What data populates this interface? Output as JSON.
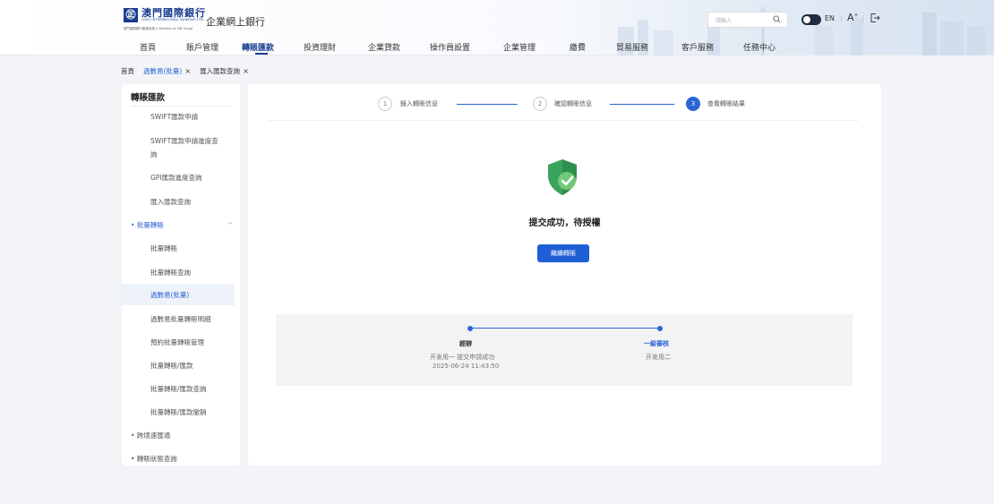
{
  "header": {
    "logo_mark": "㊣",
    "bank_name_cn": "澳門國際銀行",
    "bank_name_en": "LUSO INTERNATIONAL BANKING LTD.",
    "sub_text": "廈門國際銀行集團成員 A Member of XIB Group",
    "app_title": "企業網上銀行",
    "search_placeholder": "請輸入",
    "lang_label": "EN",
    "font_size_label": "A",
    "font_size_sup": "+"
  },
  "nav": {
    "items": [
      {
        "label": "首頁"
      },
      {
        "label": "賬戶管理"
      },
      {
        "label": "轉賬匯款"
      },
      {
        "label": "投資理財"
      },
      {
        "label": "企業貸款"
      },
      {
        "label": "操作員設置"
      },
      {
        "label": "企業管理"
      },
      {
        "label": "繳費"
      },
      {
        "label": "貿易服務"
      },
      {
        "label": "客戶服務"
      },
      {
        "label": "任務中心"
      }
    ],
    "active_index": 2
  },
  "tabs": [
    {
      "label": "首頁",
      "closable": false
    },
    {
      "label": "過數易(批量)",
      "closable": true,
      "active": true
    },
    {
      "label": "匯入匯款查詢",
      "closable": true
    }
  ],
  "sidebar": {
    "title": "轉賬匯款",
    "items": [
      {
        "label": "SWIFT匯款申請"
      },
      {
        "label": "SWIFT匯款申請進度查"
      },
      {
        "label": "詢"
      },
      {
        "label": "GPI匯款進度查詢"
      },
      {
        "label": "匯入匯款查詢"
      },
      {
        "label": "• 批量轉賬"
      },
      {
        "label": "批量轉賬"
      },
      {
        "label": "批量轉賬查詢"
      },
      {
        "label": "過數易(批量)"
      },
      {
        "label": "過數易批量轉賬明細"
      },
      {
        "label": "預約批量轉賬管理"
      },
      {
        "label": "批量轉賬/匯款"
      },
      {
        "label": "批量轉賬/匯款查詢"
      },
      {
        "label": "批量轉賬/匯款撤銷"
      },
      {
        "label": "• 跨境速匯通"
      },
      {
        "label": "• 轉賬狀態查詢"
      }
    ],
    "group_chevron": "^"
  },
  "steps": [
    {
      "num": "1",
      "label": "錄入轉賬信息"
    },
    {
      "num": "2",
      "label": "確認轉賬信息"
    },
    {
      "num": "3",
      "label": "查看轉賬結果"
    }
  ],
  "result": {
    "title": "提交成功，待授權",
    "continue_label": "繼續轉賬"
  },
  "flow": {
    "nodes": [
      {
        "title": "經辦",
        "line1": "开发用一 提交申請成功",
        "line2": "2025-06-24 11:43:50"
      },
      {
        "title": "一級審核",
        "line1": "开发用二",
        "line2": ""
      }
    ]
  },
  "colors": {
    "brand": "#1a3d8f",
    "accent": "#2b64d6",
    "success": "#3cb371",
    "background": "#f2f4f7"
  }
}
